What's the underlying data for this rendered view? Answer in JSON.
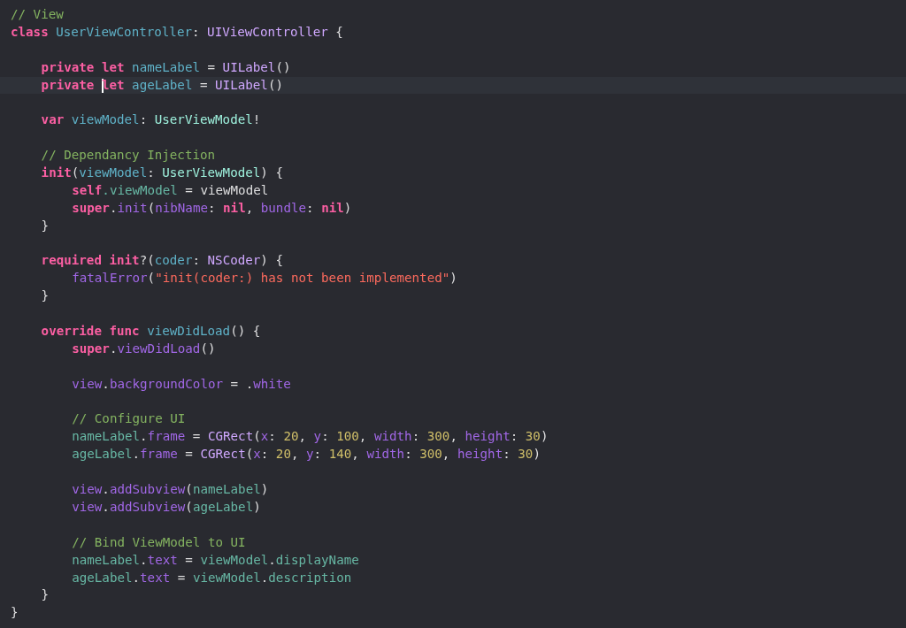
{
  "editor": {
    "lines": [
      {
        "kind": "code",
        "tokens": [
          {
            "text": "// View",
            "kind": "comment"
          }
        ]
      },
      {
        "kind": "code",
        "tokens": [
          {
            "text": "class ",
            "kind": "keyword"
          },
          {
            "text": "UserViewController",
            "kind": "decl"
          },
          {
            "text": ": ",
            "kind": "plain"
          },
          {
            "text": "UIViewController",
            "kind": "system_type"
          },
          {
            "text": " {",
            "kind": "plain"
          }
        ],
        "children": [
          {
            "kind": "blank"
          },
          {
            "kind": "code",
            "tokens": [
              {
                "text": "private let ",
                "kind": "keyword"
              },
              {
                "text": "nameLabel",
                "kind": "decl"
              },
              {
                "text": " = ",
                "kind": "plain"
              },
              {
                "text": "UILabel",
                "kind": "system_type"
              },
              {
                "text": "()",
                "kind": "plain"
              }
            ]
          },
          {
            "kind": "code",
            "current": true,
            "tokens": [
              {
                "text": "private ",
                "kind": "keyword"
              },
              {
                "text": "let ",
                "kind": "keyword",
                "caret": true
              },
              {
                "text": "ageLabel",
                "kind": "decl"
              },
              {
                "text": " = ",
                "kind": "plain"
              },
              {
                "text": "UILabel",
                "kind": "system_type"
              },
              {
                "text": "()",
                "kind": "plain"
              }
            ]
          },
          {
            "kind": "blank"
          },
          {
            "kind": "code",
            "tokens": [
              {
                "text": "var ",
                "kind": "keyword"
              },
              {
                "text": "viewModel",
                "kind": "decl"
              },
              {
                "text": ": ",
                "kind": "plain"
              },
              {
                "text": "UserViewModel",
                "kind": "project_type"
              },
              {
                "text": "!",
                "kind": "plain"
              }
            ]
          },
          {
            "kind": "blank"
          },
          {
            "kind": "code",
            "tokens": [
              {
                "text": "// Dependancy Injection",
                "kind": "comment"
              }
            ]
          },
          {
            "kind": "code",
            "tokens": [
              {
                "text": "init",
                "kind": "keyword"
              },
              {
                "text": "(",
                "kind": "plain"
              },
              {
                "text": "viewModel",
                "kind": "decl"
              },
              {
                "text": ": ",
                "kind": "plain"
              },
              {
                "text": "UserViewModel",
                "kind": "project_type"
              },
              {
                "text": ") {",
                "kind": "plain"
              }
            ],
            "children": [
              {
                "kind": "code",
                "tokens": [
                  {
                    "text": "self",
                    "kind": "keyword"
                  },
                  {
                    "text": ".viewModel",
                    "kind": "project"
                  },
                  {
                    "text": " = viewModel",
                    "kind": "plain"
                  }
                ]
              },
              {
                "kind": "code",
                "tokens": [
                  {
                    "text": "super",
                    "kind": "keyword"
                  },
                  {
                    "text": ".",
                    "kind": "plain"
                  },
                  {
                    "text": "init",
                    "kind": "system"
                  },
                  {
                    "text": "(",
                    "kind": "plain"
                  },
                  {
                    "text": "nibName",
                    "kind": "system"
                  },
                  {
                    "text": ": ",
                    "kind": "plain"
                  },
                  {
                    "text": "nil",
                    "kind": "keyword"
                  },
                  {
                    "text": ", ",
                    "kind": "plain"
                  },
                  {
                    "text": "bundle",
                    "kind": "system"
                  },
                  {
                    "text": ": ",
                    "kind": "plain"
                  },
                  {
                    "text": "nil",
                    "kind": "keyword"
                  },
                  {
                    "text": ")",
                    "kind": "plain"
                  }
                ]
              }
            ]
          },
          {
            "kind": "code",
            "tokens": [
              {
                "text": "}",
                "kind": "plain"
              }
            ]
          },
          {
            "kind": "blank"
          },
          {
            "kind": "code",
            "tokens": [
              {
                "text": "required init",
                "kind": "keyword"
              },
              {
                "text": "?(",
                "kind": "plain"
              },
              {
                "text": "coder",
                "kind": "decl"
              },
              {
                "text": ": ",
                "kind": "plain"
              },
              {
                "text": "NSCoder",
                "kind": "system_type"
              },
              {
                "text": ") {",
                "kind": "plain"
              }
            ],
            "children": [
              {
                "kind": "code",
                "tokens": [
                  {
                    "text": "fatalError",
                    "kind": "system"
                  },
                  {
                    "text": "(",
                    "kind": "plain"
                  },
                  {
                    "text": "\"init(coder:) has not been implemented\"",
                    "kind": "string"
                  },
                  {
                    "text": ")",
                    "kind": "plain"
                  }
                ]
              }
            ]
          },
          {
            "kind": "code",
            "tokens": [
              {
                "text": "}",
                "kind": "plain"
              }
            ]
          },
          {
            "kind": "blank"
          },
          {
            "kind": "code",
            "tokens": [
              {
                "text": "override func ",
                "kind": "keyword"
              },
              {
                "text": "viewDidLoad",
                "kind": "decl"
              },
              {
                "text": "() {",
                "kind": "plain"
              }
            ],
            "children": [
              {
                "kind": "code",
                "tokens": [
                  {
                    "text": "super",
                    "kind": "keyword"
                  },
                  {
                    "text": ".",
                    "kind": "plain"
                  },
                  {
                    "text": "viewDidLoad",
                    "kind": "system"
                  },
                  {
                    "text": "()",
                    "kind": "plain"
                  }
                ]
              },
              {
                "kind": "blank"
              },
              {
                "kind": "code",
                "tokens": [
                  {
                    "text": "view",
                    "kind": "system"
                  },
                  {
                    "text": ".",
                    "kind": "plain"
                  },
                  {
                    "text": "backgroundColor",
                    "kind": "system"
                  },
                  {
                    "text": " = .",
                    "kind": "plain"
                  },
                  {
                    "text": "white",
                    "kind": "system"
                  }
                ]
              },
              {
                "kind": "blank"
              },
              {
                "kind": "code",
                "tokens": [
                  {
                    "text": "// Configure UI",
                    "kind": "comment"
                  }
                ]
              },
              {
                "kind": "code",
                "tokens": [
                  {
                    "text": "nameLabel",
                    "kind": "project"
                  },
                  {
                    "text": ".",
                    "kind": "plain"
                  },
                  {
                    "text": "frame",
                    "kind": "system"
                  },
                  {
                    "text": " = ",
                    "kind": "plain"
                  },
                  {
                    "text": "CGRect",
                    "kind": "system_type"
                  },
                  {
                    "text": "(",
                    "kind": "plain"
                  },
                  {
                    "text": "x",
                    "kind": "system"
                  },
                  {
                    "text": ": ",
                    "kind": "plain"
                  },
                  {
                    "text": "20",
                    "kind": "number"
                  },
                  {
                    "text": ", ",
                    "kind": "plain"
                  },
                  {
                    "text": "y",
                    "kind": "system"
                  },
                  {
                    "text": ": ",
                    "kind": "plain"
                  },
                  {
                    "text": "100",
                    "kind": "number"
                  },
                  {
                    "text": ", ",
                    "kind": "plain"
                  },
                  {
                    "text": "width",
                    "kind": "system"
                  },
                  {
                    "text": ": ",
                    "kind": "plain"
                  },
                  {
                    "text": "300",
                    "kind": "number"
                  },
                  {
                    "text": ", ",
                    "kind": "plain"
                  },
                  {
                    "text": "height",
                    "kind": "system"
                  },
                  {
                    "text": ": ",
                    "kind": "plain"
                  },
                  {
                    "text": "30",
                    "kind": "number"
                  },
                  {
                    "text": ")",
                    "kind": "plain"
                  }
                ]
              },
              {
                "kind": "code",
                "tokens": [
                  {
                    "text": "ageLabel",
                    "kind": "project"
                  },
                  {
                    "text": ".",
                    "kind": "plain"
                  },
                  {
                    "text": "frame",
                    "kind": "system"
                  },
                  {
                    "text": " = ",
                    "kind": "plain"
                  },
                  {
                    "text": "CGRect",
                    "kind": "system_type"
                  },
                  {
                    "text": "(",
                    "kind": "plain"
                  },
                  {
                    "text": "x",
                    "kind": "system"
                  },
                  {
                    "text": ": ",
                    "kind": "plain"
                  },
                  {
                    "text": "20",
                    "kind": "number"
                  },
                  {
                    "text": ", ",
                    "kind": "plain"
                  },
                  {
                    "text": "y",
                    "kind": "system"
                  },
                  {
                    "text": ": ",
                    "kind": "plain"
                  },
                  {
                    "text": "140",
                    "kind": "number"
                  },
                  {
                    "text": ", ",
                    "kind": "plain"
                  },
                  {
                    "text": "width",
                    "kind": "system"
                  },
                  {
                    "text": ": ",
                    "kind": "plain"
                  },
                  {
                    "text": "300",
                    "kind": "number"
                  },
                  {
                    "text": ", ",
                    "kind": "plain"
                  },
                  {
                    "text": "height",
                    "kind": "system"
                  },
                  {
                    "text": ": ",
                    "kind": "plain"
                  },
                  {
                    "text": "30",
                    "kind": "number"
                  },
                  {
                    "text": ")",
                    "kind": "plain"
                  }
                ]
              },
              {
                "kind": "blank"
              },
              {
                "kind": "code",
                "tokens": [
                  {
                    "text": "view",
                    "kind": "system"
                  },
                  {
                    "text": ".",
                    "kind": "plain"
                  },
                  {
                    "text": "addSubview",
                    "kind": "system"
                  },
                  {
                    "text": "(",
                    "kind": "plain"
                  },
                  {
                    "text": "nameLabel",
                    "kind": "project"
                  },
                  {
                    "text": ")",
                    "kind": "plain"
                  }
                ]
              },
              {
                "kind": "code",
                "tokens": [
                  {
                    "text": "view",
                    "kind": "system"
                  },
                  {
                    "text": ".",
                    "kind": "plain"
                  },
                  {
                    "text": "addSubview",
                    "kind": "system"
                  },
                  {
                    "text": "(",
                    "kind": "plain"
                  },
                  {
                    "text": "ageLabel",
                    "kind": "project"
                  },
                  {
                    "text": ")",
                    "kind": "plain"
                  }
                ]
              },
              {
                "kind": "blank"
              },
              {
                "kind": "code",
                "tokens": [
                  {
                    "text": "// Bind ViewModel to UI",
                    "kind": "comment"
                  }
                ]
              },
              {
                "kind": "code",
                "tokens": [
                  {
                    "text": "nameLabel",
                    "kind": "project"
                  },
                  {
                    "text": ".",
                    "kind": "plain"
                  },
                  {
                    "text": "text",
                    "kind": "system"
                  },
                  {
                    "text": " = ",
                    "kind": "plain"
                  },
                  {
                    "text": "viewModel",
                    "kind": "project"
                  },
                  {
                    "text": ".",
                    "kind": "plain"
                  },
                  {
                    "text": "displayName",
                    "kind": "project"
                  }
                ]
              },
              {
                "kind": "code",
                "tokens": [
                  {
                    "text": "ageLabel",
                    "kind": "project"
                  },
                  {
                    "text": ".",
                    "kind": "plain"
                  },
                  {
                    "text": "text",
                    "kind": "system"
                  },
                  {
                    "text": " = ",
                    "kind": "plain"
                  },
                  {
                    "text": "viewModel",
                    "kind": "project"
                  },
                  {
                    "text": ".",
                    "kind": "plain"
                  },
                  {
                    "text": "description",
                    "kind": "project"
                  }
                ]
              }
            ]
          },
          {
            "kind": "code",
            "tokens": [
              {
                "text": "}",
                "kind": "plain"
              }
            ]
          }
        ]
      },
      {
        "kind": "code",
        "tokens": [
          {
            "text": "}",
            "kind": "plain"
          }
        ]
      }
    ]
  }
}
